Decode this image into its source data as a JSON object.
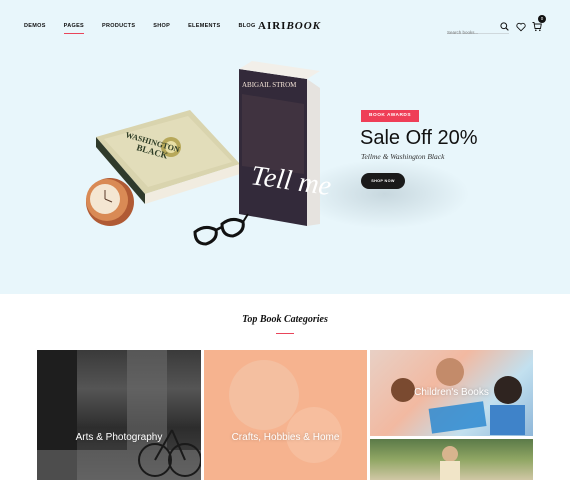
{
  "nav": {
    "items": [
      "DEMOS",
      "PAGES",
      "PRODUCTS",
      "SHOP",
      "ELEMENTS",
      "BLOG"
    ],
    "active": "PAGES"
  },
  "logo": {
    "part1": "AIRI",
    "part2": "BOOK"
  },
  "search": {
    "placeholder": "Search books..."
  },
  "cart": {
    "count": "0"
  },
  "hero": {
    "badge": "BOOK AWARDS",
    "title": "Sale Off 20%",
    "subtitle": "Tellme & Washington Black",
    "button": "SHOP NOW",
    "book_left": {
      "title_line1": "WASHINGTON",
      "title_line2": "BLACK"
    },
    "book_right": {
      "author": "ABIGAIL STROM",
      "title": "Tell me"
    }
  },
  "categories": {
    "title": "Top Book Categories",
    "tiles": [
      {
        "label": "Arts & Photography"
      },
      {
        "label": "Crafts, Hobbies & Home"
      },
      {
        "label": "Children's Books"
      },
      {
        "label": ""
      }
    ]
  },
  "colors": {
    "accent": "#ef3e57",
    "hero_bg": "#e8f6fb",
    "peach": "#f6b38f"
  }
}
